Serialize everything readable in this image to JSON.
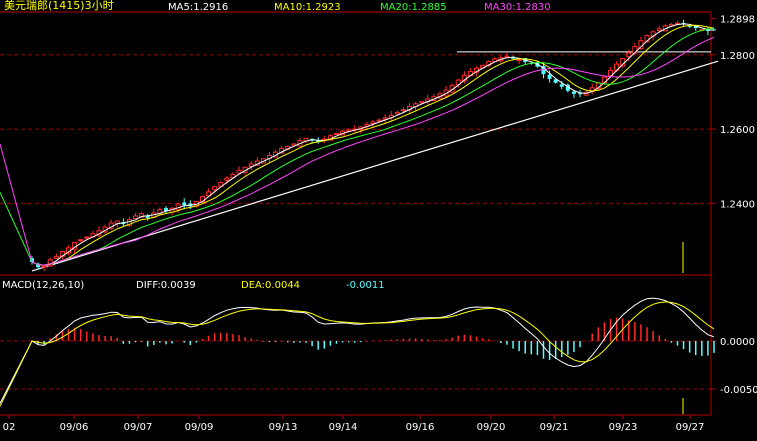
{
  "header": {
    "symbol": "美元瑞郎(1415)3小时",
    "ma5": "MA5:1.2916",
    "ma10": "MA10:1.2923",
    "ma20": "MA20:1.2885",
    "ma30": "MA30:1.2830"
  },
  "macd_header": {
    "name": "MACD(12,26,10)",
    "diff": "DIFF:0.0039",
    "dea": "DEA:0.0044",
    "macd": "-0.0011"
  },
  "colors": {
    "up": "#ff2a2a",
    "down": "#54ffff",
    "ma5": "#ffffff",
    "ma10": "#ffff00",
    "ma20": "#2bff2b",
    "ma30": "#ff44ff",
    "grid": "#990000",
    "axis": "#b40000",
    "text": "#ffffff"
  },
  "chart_data": [
    {
      "type": "candlestick",
      "title": "美元瑞郎(1415)3小时",
      "y_ticks": [
        "1.2898",
        "1.2800",
        "1.2600",
        "1.2400"
      ],
      "ylim": [
        1.2215,
        1.291
      ],
      "x_tick_labels": [
        "02",
        "09/06",
        "09/07",
        "09/09",
        "09/13",
        "09/14",
        "09/16",
        "09/20",
        "09/21",
        "09/23",
        "09/27"
      ],
      "grid": true,
      "candles_close": [
        1.2242,
        1.2228,
        1.2231,
        1.2248,
        1.2257,
        1.227,
        1.228,
        1.2295,
        1.2302,
        1.2309,
        1.2318,
        1.2326,
        1.2336,
        1.2347,
        1.2352,
        1.2344,
        1.2356,
        1.2366,
        1.2372,
        1.2361,
        1.2374,
        1.2383,
        1.2379,
        1.2387,
        1.2398,
        1.2395,
        1.2392,
        1.2405,
        1.2418,
        1.2431,
        1.2445,
        1.2456,
        1.2468,
        1.2478,
        1.2489,
        1.2497,
        1.2506,
        1.2514,
        1.252,
        1.2529,
        1.2538,
        1.2548,
        1.2553,
        1.256,
        1.2569,
        1.2575,
        1.257,
        1.2565,
        1.2573,
        1.2582,
        1.2588,
        1.2594,
        1.2597,
        1.26,
        1.2606,
        1.2613,
        1.2619,
        1.2624,
        1.263,
        1.2637,
        1.2645,
        1.2652,
        1.2661,
        1.2668,
        1.2674,
        1.2681,
        1.2687,
        1.2695,
        1.2705,
        1.2718,
        1.2732,
        1.2745,
        1.2755,
        1.2764,
        1.2772,
        1.2782,
        1.2789,
        1.2792,
        1.2796,
        1.279,
        1.2787,
        1.2781,
        1.2776,
        1.2768,
        1.2748,
        1.2735,
        1.2725,
        1.2714,
        1.2703,
        1.2695,
        1.2694,
        1.2699,
        1.2711,
        1.2724,
        1.274,
        1.2758,
        1.2775,
        1.279,
        1.2805,
        1.2822,
        1.2838,
        1.2852,
        1.2862,
        1.287,
        1.2878,
        1.2882,
        1.2885,
        1.2883,
        1.2878,
        1.2872,
        1.2868,
        1.2864,
        1.2866
      ],
      "moving_averages": [
        {
          "name": "MA5",
          "last": 1.2916
        },
        {
          "name": "MA10",
          "last": 1.2923
        },
        {
          "name": "MA20",
          "last": 1.2885
        },
        {
          "name": "MA30",
          "last": 1.283
        }
      ]
    },
    {
      "type": "bar",
      "title": "MACD(12,26,10)",
      "y_ticks": [
        "0.0000",
        "-0.0050"
      ],
      "ylim": [
        -0.0075,
        0.0048
      ],
      "diff": 0.0039,
      "dea": 0.0044,
      "macd": -0.0011
    }
  ]
}
